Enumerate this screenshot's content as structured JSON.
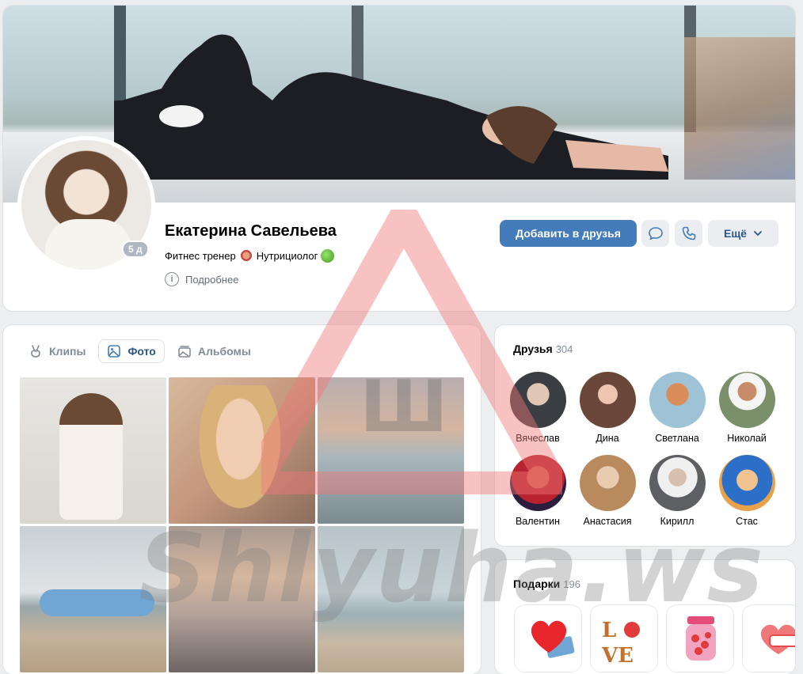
{
  "profile": {
    "name": "Екатерина Савельева",
    "status_part1": "Фитнес тренер",
    "status_part2": "Нутрициолог",
    "more_info": "Подробнее",
    "online_badge": "5 д"
  },
  "actions": {
    "add_friend": "Добавить в друзья",
    "more": "Ещё"
  },
  "photos": {
    "tabs": [
      {
        "label": "Клипы",
        "icon": "clips-icon"
      },
      {
        "label": "Фото",
        "icon": "photo-icon",
        "active": true
      },
      {
        "label": "Альбомы",
        "icon": "albums-icon"
      }
    ]
  },
  "friends": {
    "title": "Друзья",
    "count": "304",
    "items": [
      {
        "name": "Вячеслав",
        "color": "#3a3d42"
      },
      {
        "name": "Дина",
        "color": "#6a4738"
      },
      {
        "name": "Светлана",
        "color": "#c98b63"
      },
      {
        "name": "Николай",
        "color": "#7a8f6a"
      },
      {
        "name": "Валентин",
        "color": "#b8232f"
      },
      {
        "name": "Анастасия",
        "color": "#b98a5e"
      },
      {
        "name": "Кирилл",
        "color": "#5d5f63"
      },
      {
        "name": "Стас",
        "color": "#2b6fc9"
      }
    ]
  },
  "gifts": {
    "title": "Подарки",
    "count": "196",
    "items": [
      {
        "icon": "heart-phone-icon"
      },
      {
        "icon": "love-letters-icon"
      },
      {
        "icon": "candy-jar-icon"
      },
      {
        "icon": "heart-card-icon"
      }
    ]
  },
  "watermark": {
    "text": "Shlyuha.ws",
    "logo_letter": "Ш"
  },
  "colors": {
    "accent": "#447bba",
    "link": "#2a5885",
    "secondary_text": "#818c99",
    "background": "#edeef0"
  }
}
